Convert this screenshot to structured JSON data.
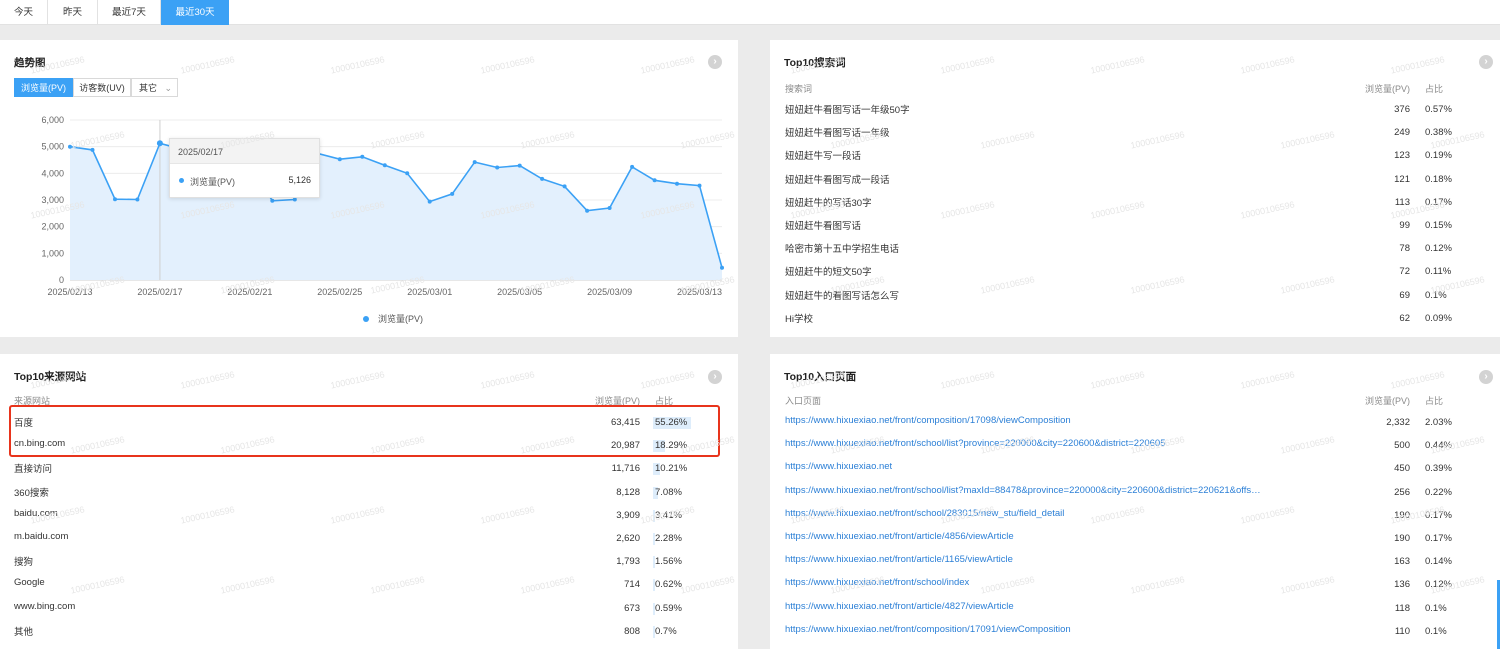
{
  "tabs": [
    "今天",
    "昨天",
    "最近7天",
    "最近30天"
  ],
  "watermark": "10000106596",
  "trend": {
    "title": "趋势图",
    "metrics": [
      "浏览量(PV)",
      "访客数(UV)",
      "其它"
    ],
    "legend": "浏览量(PV)",
    "tooltip": {
      "date": "2025/02/17",
      "series": "浏览量(PV)",
      "value": "5,126"
    }
  },
  "chart_data": {
    "type": "area",
    "title": "趋势图",
    "series": [
      {
        "name": "浏览量(PV)",
        "values": [
          5000,
          4880,
          3030,
          3020,
          5126,
          4900,
          4750,
          4800,
          4400,
          2970,
          3020,
          4750,
          4530,
          4620,
          4300,
          4000,
          2940,
          3230,
          4420,
          4220,
          4290,
          3790,
          3510,
          2600,
          2700,
          4240,
          3740,
          3610,
          3540,
          460
        ]
      }
    ],
    "x": [
      "2025/02/13",
      "2025/02/14",
      "2025/02/15",
      "2025/02/16",
      "2025/02/17",
      "2025/02/18",
      "2025/02/19",
      "2025/02/20",
      "2025/02/21",
      "2025/02/22",
      "2025/02/23",
      "2025/02/24",
      "2025/02/25",
      "2025/02/26",
      "2025/02/27",
      "2025/02/28",
      "2025/03/01",
      "2025/03/02",
      "2025/03/03",
      "2025/03/04",
      "2025/03/05",
      "2025/03/06",
      "2025/03/07",
      "2025/03/08",
      "2025/03/09",
      "2025/03/10",
      "2025/03/11",
      "2025/03/12",
      "2025/03/13",
      "2025/03/14"
    ],
    "x_tick_labels": [
      "2025/02/13",
      "2025/02/17",
      "2025/02/21",
      "2025/02/25",
      "2025/03/01",
      "2025/03/05",
      "2025/03/09",
      "2025/03/13"
    ],
    "y_tick_labels": [
      "0",
      "1,000",
      "2,000",
      "3,000",
      "4,000",
      "5,000",
      "6,000"
    ],
    "ylim": [
      0,
      6000
    ],
    "grid": true,
    "legend_position": "bottom",
    "color": "#3ba1f5"
  },
  "search": {
    "title": "Top10搜索词",
    "headers": [
      "搜索词",
      "浏览量(PV)",
      "占比"
    ],
    "rows": [
      {
        "term": "妞妞赶牛看图写话一年级50字",
        "pv": "376",
        "pct": "0.57%"
      },
      {
        "term": "妞妞赶牛看图写话一年级",
        "pv": "249",
        "pct": "0.38%"
      },
      {
        "term": "妞妞赶牛写一段话",
        "pv": "123",
        "pct": "0.19%"
      },
      {
        "term": "妞妞赶牛看图写成一段话",
        "pv": "121",
        "pct": "0.18%"
      },
      {
        "term": "妞妞赶牛的写话30字",
        "pv": "113",
        "pct": "0.17%"
      },
      {
        "term": "妞妞赶牛看图写话",
        "pv": "99",
        "pct": "0.15%"
      },
      {
        "term": "哈密市第十五中学招生电话",
        "pv": "78",
        "pct": "0.12%"
      },
      {
        "term": "妞妞赶牛的短文50字",
        "pv": "72",
        "pct": "0.11%"
      },
      {
        "term": "妞妞赶牛的看图写话怎么写",
        "pv": "69",
        "pct": "0.1%"
      },
      {
        "term": "Hi学校",
        "pv": "62",
        "pct": "0.09%"
      }
    ]
  },
  "sources": {
    "title": "Top10来源网站",
    "headers": [
      "来源网站",
      "浏览量(PV)",
      "占比"
    ],
    "rows": [
      {
        "site": "百度",
        "pv": "63,415",
        "pct": "55.26%",
        "share": 0.5526
      },
      {
        "site": "cn.bing.com",
        "pv": "20,987",
        "pct": "18.29%",
        "share": 0.1829
      },
      {
        "site": "直接访问",
        "pv": "11,716",
        "pct": "10.21%",
        "share": 0.1021
      },
      {
        "site": "360搜索",
        "pv": "8,128",
        "pct": "7.08%",
        "share": 0.0708
      },
      {
        "site": "baidu.com",
        "pv": "3,909",
        "pct": "3.41%",
        "share": 0.0341
      },
      {
        "site": "m.baidu.com",
        "pv": "2,620",
        "pct": "2.28%",
        "share": 0.0228
      },
      {
        "site": "搜狗",
        "pv": "1,793",
        "pct": "1.56%",
        "share": 0.0156
      },
      {
        "site": "Google",
        "pv": "714",
        "pct": "0.62%",
        "share": 0.0062
      },
      {
        "site": "www.bing.com",
        "pv": "673",
        "pct": "0.59%",
        "share": 0.0059
      },
      {
        "site": "其他",
        "pv": "808",
        "pct": "0.7%",
        "share": 0.007
      }
    ],
    "highlight_color": "#e8341c"
  },
  "entry": {
    "title": "Top10入口页面",
    "headers": [
      "入口页面",
      "浏览量(PV)",
      "占比"
    ],
    "rows": [
      {
        "url": "https://www.hixuexiao.net/front/composition/17098/viewComposition",
        "pv": "2,332",
        "pct": "2.03%"
      },
      {
        "url": "https://www.hixuexiao.net/front/school/list?province=220000&city=220600&district=220605",
        "pv": "500",
        "pct": "0.44%"
      },
      {
        "url": "https://www.hixuexiao.net",
        "pv": "450",
        "pct": "0.39%"
      },
      {
        "url": "https://www.hixuexiao.net/front/school/list?maxId=88478&province=220000&city=220600&district=220621&offset=...",
        "pv": "256",
        "pct": "0.22%"
      },
      {
        "url": "https://www.hixuexiao.net/front/school/283015/new_stu/field_detail",
        "pv": "190",
        "pct": "0.17%"
      },
      {
        "url": "https://www.hixuexiao.net/front/article/4856/viewArticle",
        "pv": "190",
        "pct": "0.17%"
      },
      {
        "url": "https://www.hixuexiao.net/front/article/1165/viewArticle",
        "pv": "163",
        "pct": "0.14%"
      },
      {
        "url": "https://www.hixuexiao.net/front/school/index",
        "pv": "136",
        "pct": "0.12%"
      },
      {
        "url": "https://www.hixuexiao.net/front/article/4827/viewArticle",
        "pv": "118",
        "pct": "0.1%"
      },
      {
        "url": "https://www.hixuexiao.net/front/composition/17091/viewComposition",
        "pv": "110",
        "pct": "0.1%"
      }
    ]
  }
}
